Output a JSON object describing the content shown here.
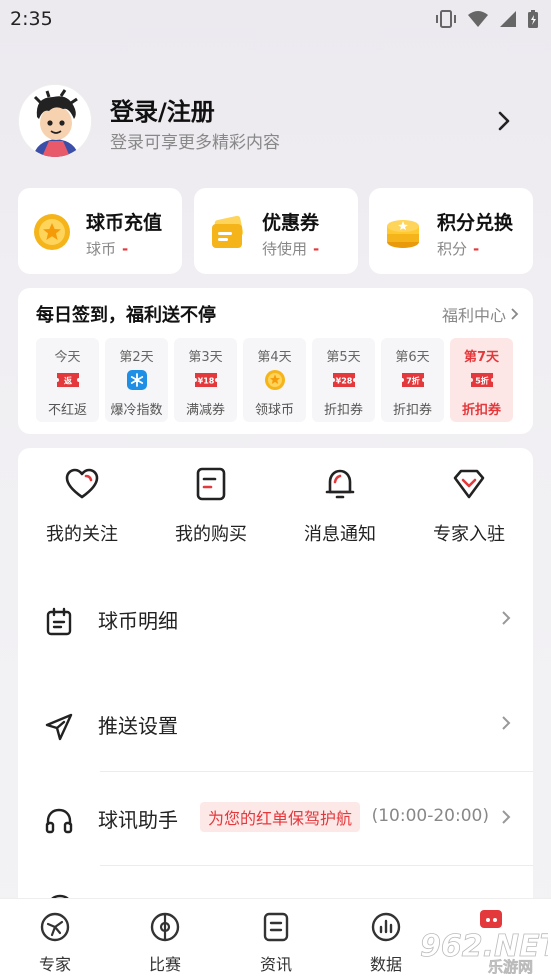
{
  "status_bar": {
    "time": "2:35"
  },
  "profile": {
    "title": "登录/注册",
    "subtitle": "登录可享更多精彩内容"
  },
  "cards": [
    {
      "title": "球币充值",
      "sub_label": "球币",
      "value": "-",
      "icon": "coin-star-icon"
    },
    {
      "title": "优惠券",
      "sub_label": "待使用",
      "value": "-",
      "icon": "coupon-icon"
    },
    {
      "title": "积分兑换",
      "sub_label": "积分",
      "value": "-",
      "icon": "points-stack-icon"
    }
  ],
  "signin": {
    "title": "每日签到，福利送不停",
    "link": "福利中心",
    "days": [
      {
        "label": "今天",
        "icon_text": "返",
        "reward": "不红返",
        "icon": "ticket-icon",
        "highlight": false
      },
      {
        "label": "第2天",
        "icon_text": "",
        "reward": "爆冷指数",
        "icon": "snowflake-icon",
        "highlight": false
      },
      {
        "label": "第3天",
        "icon_text": "¥18",
        "reward": "满减券",
        "icon": "ticket-icon",
        "highlight": false
      },
      {
        "label": "第4天",
        "icon_text": "",
        "reward": "领球币",
        "icon": "coin-star-icon",
        "highlight": false
      },
      {
        "label": "第5天",
        "icon_text": "¥28",
        "reward": "折扣券",
        "icon": "ticket-icon",
        "highlight": false
      },
      {
        "label": "第6天",
        "icon_text": "7折",
        "reward": "折扣券",
        "icon": "ticket-icon",
        "highlight": false
      },
      {
        "label": "第7天",
        "icon_text": "5折",
        "reward": "折扣券",
        "icon": "ticket-icon",
        "highlight": true
      }
    ]
  },
  "quick_actions": [
    {
      "label": "我的关注",
      "icon": "heart-icon"
    },
    {
      "label": "我的购买",
      "icon": "receipt-icon"
    },
    {
      "label": "消息通知",
      "icon": "bell-icon"
    },
    {
      "label": "专家入驻",
      "icon": "diamond-icon"
    }
  ],
  "menu": [
    {
      "label": "球币明细",
      "icon": "calendar-icon"
    },
    {
      "label": "推送设置",
      "icon": "send-icon"
    },
    {
      "label": "球讯助手",
      "icon": "headset-icon",
      "tag": "为您的红单保驾护航",
      "time": "(10:00-20:00)"
    }
  ],
  "tabs": [
    {
      "label": "专家",
      "icon": "expert-icon"
    },
    {
      "label": "比赛",
      "icon": "match-icon"
    },
    {
      "label": "资讯",
      "icon": "news-icon"
    },
    {
      "label": "数据",
      "icon": "data-icon"
    }
  ],
  "watermark": {
    "text": "962.NET",
    "sub": "乐游网"
  },
  "colors": {
    "accent": "#e4393c",
    "coin": "#f5b41a",
    "snow": "#1f8fe6"
  }
}
